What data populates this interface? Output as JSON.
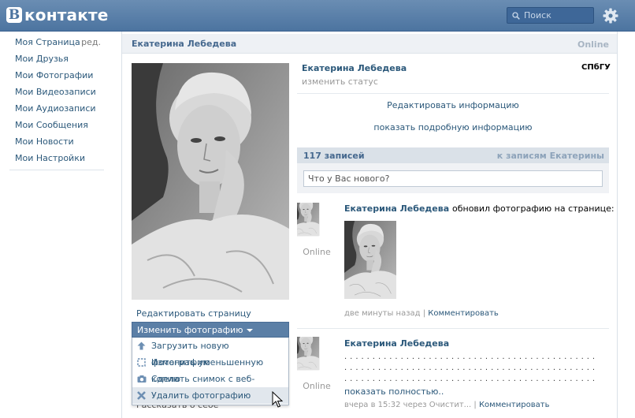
{
  "header": {
    "logo_letter": "В",
    "logo_text": "контакте",
    "search_placeholder": "Поиск"
  },
  "leftnav": {
    "items": [
      {
        "label": "Моя Страница",
        "extra": "ред."
      },
      {
        "label": "Мои Друзья"
      },
      {
        "label": "Мои Фотографии"
      },
      {
        "label": "Мои Видеозаписи"
      },
      {
        "label": "Мои Аудиозаписи"
      },
      {
        "label": "Мои Сообщения"
      },
      {
        "label": "Мои Новости"
      },
      {
        "label": "Мои Настройки"
      }
    ]
  },
  "profile": {
    "header_name": "Екатерина Лебедева",
    "header_online": "Online",
    "name": "Екатерина Лебедева",
    "status_placeholder": "изменить статус",
    "university": "СПбГУ",
    "edit_info": "Редактировать информацию",
    "more_info": "показать подробную информацию",
    "edit_page": "Редактировать страницу",
    "change_photo": "Изменить фотографию",
    "behind_text": "Рассказать о себе"
  },
  "photo_menu": {
    "items": [
      {
        "label": "Загрузить новую фотографию",
        "icon": "upload-icon"
      },
      {
        "label": "Изменить уменьшенную копию",
        "icon": "crop-icon"
      },
      {
        "label": "Сделать снимок с веб-камеры",
        "icon": "camera-icon"
      },
      {
        "label": "Удалить фотографию",
        "icon": "delete-icon",
        "hovered": true
      }
    ]
  },
  "wall": {
    "count": "117 записей",
    "link": "к записям Екатерины",
    "input_placeholder": "Что у Вас нового?",
    "posts": [
      {
        "author": "Екатерина Лебедева",
        "action": "обновил фотографию на странице:",
        "online": "Online",
        "time": "две минуты назад",
        "comment": "Комментировать"
      },
      {
        "author": "Екатерина Лебедева",
        "dots1": ". . . . . . . . . . . . . . . . . . . . . . . . . . . . . . . . . . . . . . . . . . . . . . . . . . . . . . . .",
        "dots2": ". . . . . . . . . . . . . . . . . . . . . . . . . . . . . . . . . . . . . . . . . . . . . . . . . . . . . . . .",
        "dots3": ". . . . . . . . . . . . . . . . . . . . . . . . . . . . . . . . . . . . . . . . . . . . . . . . . . . . . . . .",
        "show_full": "показать полностью..",
        "online": "Online",
        "time": "вчера в 15:32 через Очистит...",
        "comment": "Комментировать"
      }
    ]
  },
  "colors": {
    "header_bg": "#5b80aa",
    "link": "#2b587a",
    "menu_button": "#5b7fa6"
  }
}
